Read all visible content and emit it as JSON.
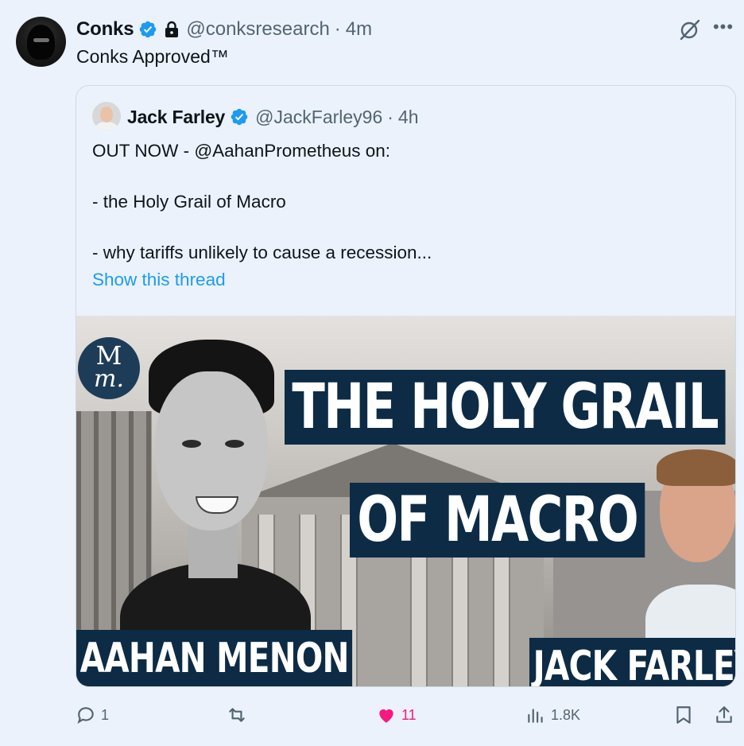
{
  "tweet": {
    "author_name": "Conks",
    "handle": "@conksresearch",
    "separator": "·",
    "time": "4m",
    "text": "Conks Approved™"
  },
  "quoted": {
    "author_name": "Jack Farley",
    "handle": "@JackFarley96",
    "separator": "·",
    "time": "4h",
    "lines": [
      "OUT NOW - @AahanPrometheus on:",
      "- the Holy Grail of Macro",
      "- why tariffs unlikely to cause a recession..."
    ],
    "show_thread": "Show this thread",
    "media": {
      "logo_line1": "M",
      "logo_line2": "m.",
      "title_line1": "THE HOLY GRAIL",
      "title_line2": "OF MACRO",
      "left_name": "AAHAN MENON",
      "right_name": "JACK FARLEY"
    }
  },
  "actions": {
    "replies": "1",
    "reposts": "",
    "likes": "11",
    "views": "1.8K"
  },
  "icons": {
    "verified": "verified-badge-icon",
    "lock": "lock-icon",
    "grok": "grok-icon",
    "more": "more-icon",
    "reply": "reply-icon",
    "repost": "repost-icon",
    "like": "heart-icon",
    "views": "views-icon",
    "bookmark": "bookmark-icon",
    "share": "share-icon"
  },
  "colors": {
    "background": "#ebf2fb",
    "link": "#1d9bf0",
    "like": "#f91880",
    "verified": "#1d9bf0",
    "banner": "#0d2b45"
  }
}
